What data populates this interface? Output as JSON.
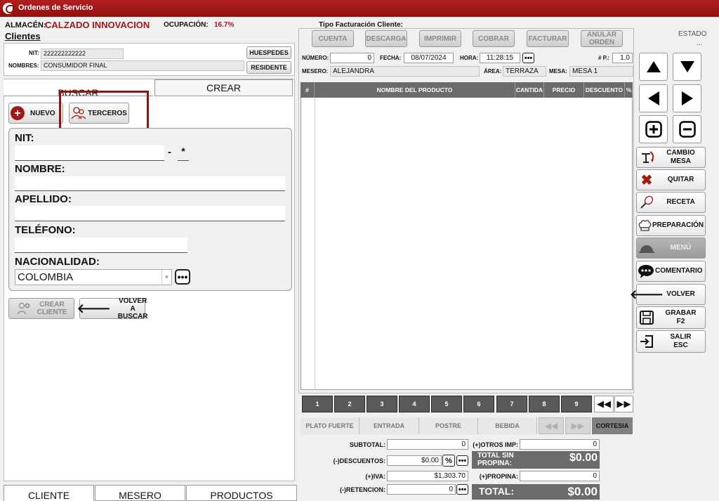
{
  "window": {
    "title": "Ordenes de Servicio"
  },
  "header": {
    "almacen_label": "ALMACÉN:",
    "almacen_value": "CALZADO INNOVACION",
    "ocupacion_label": "OCUPACIÓN:",
    "ocupacion_value": "16.7%",
    "clientes_label": "Clientes",
    "tipo_facturacion_label": "Tipo Facturación Cliente:",
    "estado_label": "ESTADO",
    "estado_value": "..."
  },
  "client_info": {
    "nit_label": "NIT:",
    "nit_value": "222222222222",
    "nombres_label": "NOMBRES:",
    "nombres_value": "CONSUMIDOR FINAL",
    "huespedes_button": "HUESPEDES",
    "residente_button": "RESIDENTE"
  },
  "left_tabs": {
    "buscar": "BUSCAR",
    "crear": "CREAR"
  },
  "client_actions": {
    "nuevo": "NUEVO",
    "terceros": "TERCEROS"
  },
  "form": {
    "nit_label": "NIT:",
    "nit_value": "",
    "dv_separator": "-",
    "dv_value": "*",
    "nombre_label": "NOMBRE:",
    "nombre_value": "",
    "apellido_label": "APELLIDO:",
    "apellido_value": "",
    "telefono_label": "TELÉFONO:",
    "telefono_value": "",
    "nacionalidad_label": "NACIONALIDAD:",
    "nacionalidad_value": "COLOMBIA"
  },
  "form_buttons": {
    "crear_cliente_1": "CREAR",
    "crear_cliente_2": "CLIENTE",
    "volver_buscar_1": "VOLVER",
    "volver_buscar_2": "A BUSCAR"
  },
  "bottom_tabs": [
    "CLIENTE",
    "MESERO",
    "PRODUCTOS"
  ],
  "toolbar": {
    "cuenta": "CUENTA",
    "descarga": "DESCARGA",
    "imprimir": "IMPRIMIR",
    "cobrar": "COBRAR",
    "facturar": "FACTURAR",
    "anular_1": "ANULAR",
    "anular_2": "ORDEN"
  },
  "order": {
    "numero_label": "NÚMERO:",
    "numero_value": "0",
    "fecha_label": "FECHA:",
    "fecha_value": "08/07/2024",
    "hora_label": "HORA:",
    "hora_value": "11:28:15",
    "np_label": "# P.:",
    "np_value": "1.0",
    "mesero_label": "MESERO:",
    "mesero_value": "ALEJANDRA",
    "area_label": "ÁREA:",
    "area_value": "TERRAZA",
    "mesa_label": "MESA:",
    "mesa_value": "MESA 1"
  },
  "table": {
    "columns": [
      "#",
      "NOMBRE DEL PRODUCTO",
      "CANTIDA",
      "PRECIO",
      "DESCUENTO",
      "%"
    ]
  },
  "pages": [
    "1",
    "2",
    "3",
    "4",
    "5",
    "6",
    "7",
    "8",
    "9"
  ],
  "categories": [
    "PLATO FUERTE",
    "ENTRADA",
    "POSTRE",
    "BEBIDA"
  ],
  "cortesia": "CORTESIA",
  "totals": {
    "subtotal_label": "SUBTOTAL:",
    "subtotal_value": "0",
    "descuentos_label": "(-)DESCUENTOS:",
    "descuentos_value": "$0.00",
    "iva_label": "(+)IVA:",
    "iva_value": "$1,303.70",
    "retencion_label": "(-)RETENCION:",
    "retencion_value": "0",
    "otros_label": "(+)OTROS IMP:",
    "otros_value": "0",
    "sin_propina_1": "TOTAL SIN",
    "sin_propina_2": "PROPINA:",
    "sin_propina_value": "$0.00",
    "propina_label": "(+)PROPINA:",
    "propina_value": "0",
    "total_label": "TOTAL:",
    "total_value": "$0.00"
  },
  "side_buttons": {
    "cambio_mesa_1": "CAMBIO",
    "cambio_mesa_2": "MESA",
    "quitar": "QUITAR",
    "receta": "RECETA",
    "preparacion": "PREPARACIÓN",
    "menu": "MENÚ",
    "comentario": "COMENTARIO",
    "volver": "VOLVER",
    "grabar_1": "GRABAR",
    "grabar_2": "F2",
    "salir_1": "SALIR",
    "salir_2": "ESC"
  },
  "colors": {
    "accent": "#a01818",
    "highlight_box": "#8b1414",
    "dark_panel": "#6b6b6b"
  }
}
